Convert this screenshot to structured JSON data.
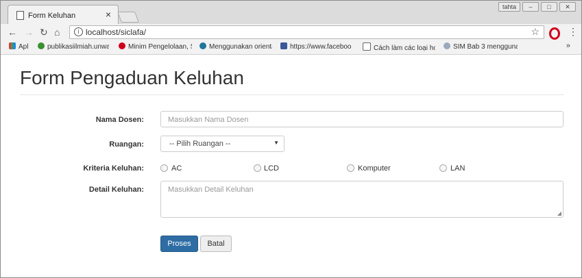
{
  "browser": {
    "tab_title": "Form Keluhan",
    "tab_close": "×",
    "url": "localhost/siclafa/",
    "window_buttons": [
      "tahta",
      "–",
      "□",
      "✕"
    ],
    "bookmarks": [
      {
        "label": "Apl"
      },
      {
        "label": "publikasiilmiah.unwah"
      },
      {
        "label": "Minim Pengelolaan, S"
      },
      {
        "label": "Menggunakan orienta"
      },
      {
        "label": "https://www.faceboo"
      },
      {
        "label": "Cách làm các loại hoa"
      },
      {
        "label": "SIM Bab 3 mengguna"
      }
    ],
    "bookmarks_more": "»"
  },
  "page": {
    "title": "Form Pengaduan Keluhan",
    "fields": {
      "nama_dosen_label": "Nama Dosen:",
      "nama_dosen_placeholder": "Masukkan Nama Dosen",
      "ruangan_label": "Ruangan:",
      "ruangan_selected": "-- Pilih Ruangan --",
      "kriteria_label": "Kriteria Keluhan:",
      "kriteria_options": [
        "AC",
        "LCD",
        "Komputer",
        "LAN"
      ],
      "detail_label": "Detail Keluhan:",
      "detail_placeholder": "Masukkan Detail Keluhan"
    },
    "buttons": {
      "submit": "Proses",
      "cancel": "Batal"
    }
  },
  "colors": {
    "primary": "#2e6da4",
    "title_text": "#333333",
    "placeholder": "#999999"
  }
}
